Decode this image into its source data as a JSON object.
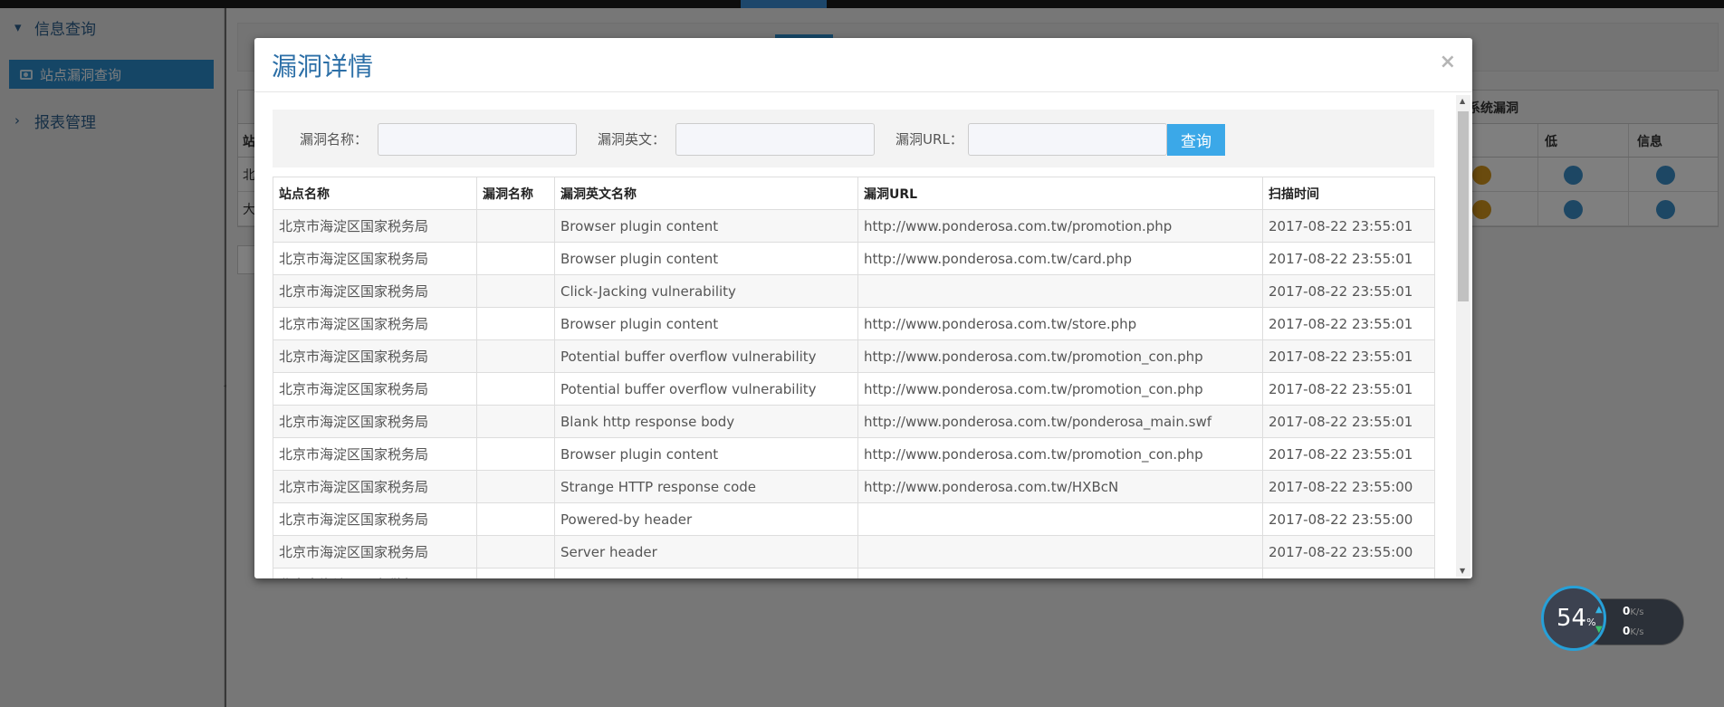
{
  "sidebar": {
    "sections": [
      {
        "label": "信息查询",
        "expanded": true
      },
      {
        "label": "报表管理",
        "expanded": false
      }
    ],
    "items": [
      {
        "label": "站点漏洞查询",
        "active": true
      }
    ]
  },
  "background_table": {
    "section_header": "系统漏洞",
    "columns": [
      "站点",
      "低",
      "信息"
    ],
    "rows": [
      "北",
      "大"
    ]
  },
  "modal": {
    "title": "漏洞详情",
    "close": "×",
    "filters": {
      "name_label": "漏洞名称：",
      "english_label": "漏洞英文：",
      "url_label": "漏洞URL：",
      "query_button": "查询"
    },
    "table": {
      "columns": [
        "站点名称",
        "漏洞名称",
        "漏洞英文名称",
        "漏洞URL",
        "扫描时间"
      ],
      "rows": [
        [
          "北京市海淀区国家税务局",
          "",
          "Browser plugin content",
          "http://www.ponderosa.com.tw/promotion.php",
          "2017-08-22 23:55:01"
        ],
        [
          "北京市海淀区国家税务局",
          "",
          "Browser plugin content",
          "http://www.ponderosa.com.tw/card.php",
          "2017-08-22 23:55:01"
        ],
        [
          "北京市海淀区国家税务局",
          "",
          "Click-Jacking vulnerability",
          "",
          "2017-08-22 23:55:01"
        ],
        [
          "北京市海淀区国家税务局",
          "",
          "Browser plugin content",
          "http://www.ponderosa.com.tw/store.php",
          "2017-08-22 23:55:01"
        ],
        [
          "北京市海淀区国家税务局",
          "",
          "Potential buffer overflow vulnerability",
          "http://www.ponderosa.com.tw/promotion_con.php",
          "2017-08-22 23:55:01"
        ],
        [
          "北京市海淀区国家税务局",
          "",
          "Potential buffer overflow vulnerability",
          "http://www.ponderosa.com.tw/promotion_con.php",
          "2017-08-22 23:55:01"
        ],
        [
          "北京市海淀区国家税务局",
          "",
          "Blank http response body",
          "http://www.ponderosa.com.tw/ponderosa_main.swf",
          "2017-08-22 23:55:01"
        ],
        [
          "北京市海淀区国家税务局",
          "",
          "Browser plugin content",
          "http://www.ponderosa.com.tw/promotion_con.php",
          "2017-08-22 23:55:01"
        ],
        [
          "北京市海淀区国家税务局",
          "",
          "Strange HTTP response code",
          "http://www.ponderosa.com.tw/HXBcN",
          "2017-08-22 23:55:00"
        ],
        [
          "北京市海淀区国家税务局",
          "",
          "Powered-by header",
          "",
          "2017-08-22 23:55:00"
        ],
        [
          "北京市海淀区国家税务局",
          "",
          "Server header",
          "",
          "2017-08-22 23:55:00"
        ],
        [
          "北京市海淀区国家税务局",
          "",
          "",
          "",
          ""
        ]
      ]
    }
  },
  "speed_widget": {
    "percent": "54",
    "percent_unit": "%",
    "upload": "0",
    "download": "0",
    "unit": "K/s"
  },
  "colors": {
    "accent": "#2b8ccd",
    "query_button": "#3ba8e8",
    "title": "#2c6fa7"
  }
}
